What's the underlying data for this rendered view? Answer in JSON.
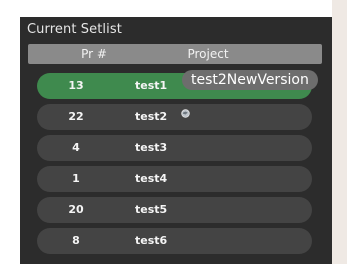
{
  "setlist": {
    "title": "Current Setlist",
    "columns": {
      "pr": "Pr #",
      "project": "Project"
    },
    "rows": [
      {
        "pr": "13",
        "project": "test1",
        "selected": true
      },
      {
        "pr": "22",
        "project": "test2",
        "selected": false
      },
      {
        "pr": "4",
        "project": "test3",
        "selected": false
      },
      {
        "pr": "1",
        "project": "test4",
        "selected": false
      },
      {
        "pr": "20",
        "project": "test5",
        "selected": false
      },
      {
        "pr": "8",
        "project": "test6",
        "selected": false
      }
    ],
    "tooltip": "test2NewVersion",
    "tooltip_icon": "globe-icon"
  },
  "colors": {
    "panel": "#2c2c2c",
    "header": "#8a8a8a",
    "row": "#444444",
    "selected_row": "#3f8a4e",
    "tooltip": "#6d6d6d"
  }
}
